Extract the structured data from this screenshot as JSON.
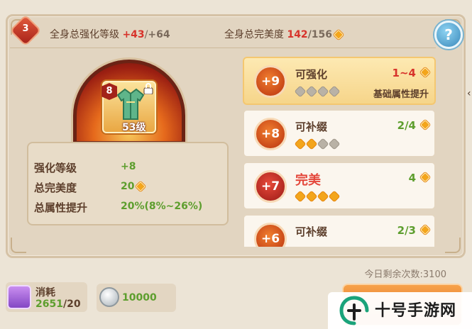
{
  "header": {
    "rank_level": "3",
    "enhance_label": "全身总强化等级",
    "enhance_current": "+43",
    "enhance_sep": "/",
    "enhance_max": "+64",
    "perfection_label": "全身总完美度",
    "perfection_current": "142",
    "perfection_max": "/156",
    "help_glyph": "?"
  },
  "equipment": {
    "enhance_badge": "8",
    "level": "53级"
  },
  "stats": {
    "rows": [
      {
        "label": "强化等级",
        "value": "+8"
      },
      {
        "label": "总完美度",
        "value": "20"
      },
      {
        "label": "总属性提升",
        "value": "20%(8%~26%)"
      }
    ]
  },
  "options": [
    {
      "badge": "+9",
      "title": "可强化",
      "count": "1~4",
      "gems_on": 0,
      "gems_total": 4,
      "subtitle": "基础属性提升",
      "selected": true
    },
    {
      "badge": "+8",
      "title": "可补缀",
      "count": "2/4",
      "gems_on": 2,
      "gems_total": 4,
      "subtitle": "",
      "selected": false
    },
    {
      "badge": "+7",
      "title": "完美",
      "count": "4",
      "gems_on": 4,
      "gems_total": 4,
      "subtitle": "",
      "selected": false
    },
    {
      "badge": "+6",
      "title": "可补缀",
      "count": "2/3",
      "gems_on": 0,
      "gems_total": 0,
      "subtitle": "",
      "selected": false
    }
  ],
  "footer": {
    "remaining": "今日剩余次数:3100",
    "cost_label": "消耗",
    "cost_have": "2651",
    "cost_need": "/20",
    "coin_value": "10000"
  },
  "watermark": {
    "text": "十号手游网"
  },
  "colors": {
    "accent_red": "#d7332b",
    "accent_green": "#5d9e2e",
    "gem_orange": "#f3a51c",
    "panel_bg": "#e2d5c1"
  }
}
